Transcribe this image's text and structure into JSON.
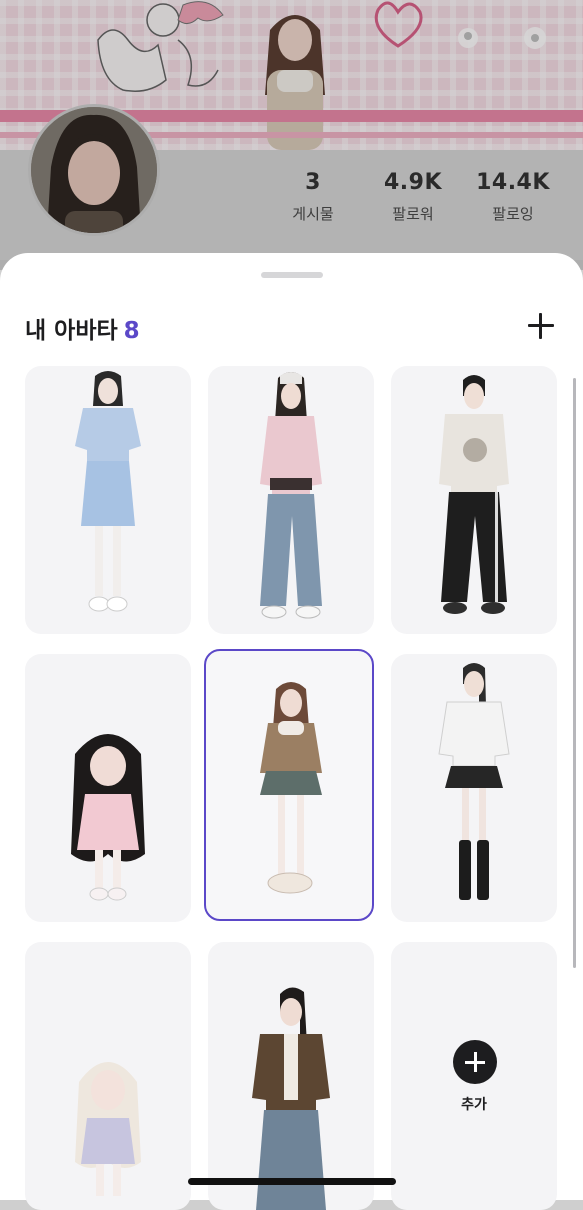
{
  "profile": {
    "stats": [
      {
        "value": "3",
        "label": "게시물"
      },
      {
        "value": "4.9K",
        "label": "팔로워"
      },
      {
        "value": "14.4K",
        "label": "팔로잉"
      }
    ]
  },
  "sheet": {
    "title": "내 아바타",
    "count": "8",
    "add_label": "추가",
    "accent_color": "#5b48c8"
  },
  "avatars": [
    {
      "name": "avatar-1",
      "outfit": "light-blue-dress",
      "selected": false
    },
    {
      "name": "avatar-2",
      "outfit": "pink-jacket-jeans",
      "selected": false
    },
    {
      "name": "avatar-3",
      "outfit": "sweatshirt-black-pants",
      "selected": false
    },
    {
      "name": "avatar-4",
      "outfit": "pink-coat-curly-hair",
      "selected": false
    },
    {
      "name": "avatar-5",
      "outfit": "brown-jacket-skirt",
      "selected": true
    },
    {
      "name": "avatar-6",
      "outfit": "white-top-black-skirt",
      "selected": false
    },
    {
      "name": "avatar-7",
      "outfit": "blonde-lilac-outfit",
      "selected": false
    },
    {
      "name": "avatar-8",
      "outfit": "brown-cardigan-cargo",
      "selected": false
    }
  ]
}
